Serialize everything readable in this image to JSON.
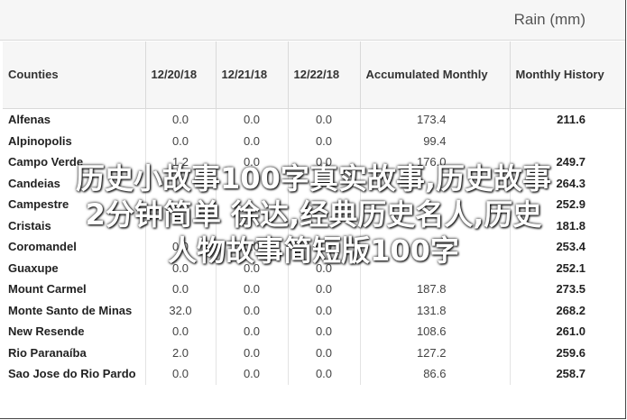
{
  "header": {
    "title": "Rain (mm)"
  },
  "table": {
    "columns": [
      "Counties",
      "12/20/18",
      "12/21/18",
      "12/22/18",
      "Accumulated Monthly",
      "Monthly History"
    ],
    "rows": [
      [
        "Alfenas",
        "0.0",
        "0.0",
        "0.0",
        "173.4",
        "211.6"
      ],
      [
        "Alpinopolis",
        "0.0",
        "0.0",
        "0.0",
        "99.4",
        ""
      ],
      [
        "Campo Verde",
        "1.2",
        "0.0",
        "0.0",
        "176.0",
        "249.7"
      ],
      [
        "Candeias",
        "",
        "",
        "",
        "",
        "264.3"
      ],
      [
        "Campestre",
        "",
        "",
        "",
        "",
        "252.9"
      ],
      [
        "Cristais",
        "",
        "",
        "",
        "",
        "181.8"
      ],
      [
        "Coromandel",
        "0.0",
        "0.0",
        "0.0",
        "",
        "253.4"
      ],
      [
        "Guaxupe",
        "0.0",
        "0.0",
        "0.0",
        "",
        "252.1"
      ],
      [
        "Mount Carmel",
        "0.0",
        "0.0",
        "0.0",
        "187.8",
        "273.5"
      ],
      [
        "Monte Santo de Minas",
        "32.0",
        "0.0",
        "0.0",
        "131.8",
        "268.2"
      ],
      [
        "New Resende",
        "0.0",
        "0.0",
        "0.0",
        "108.6",
        "261.0"
      ],
      [
        "Rio Paranaíba",
        "2.0",
        "0.0",
        "0.0",
        "127.2",
        "259.6"
      ],
      [
        "Sao Jose do Rio Pardo",
        "0.0",
        "0.0",
        "0.0",
        "86.6",
        "258.7"
      ]
    ]
  },
  "overlay": {
    "line1": "历史小故事100字真实故事,历史故事",
    "line2": "2分钟简单 徐达,经典历史名人,历史",
    "line3": "人物故事简短版100字"
  }
}
